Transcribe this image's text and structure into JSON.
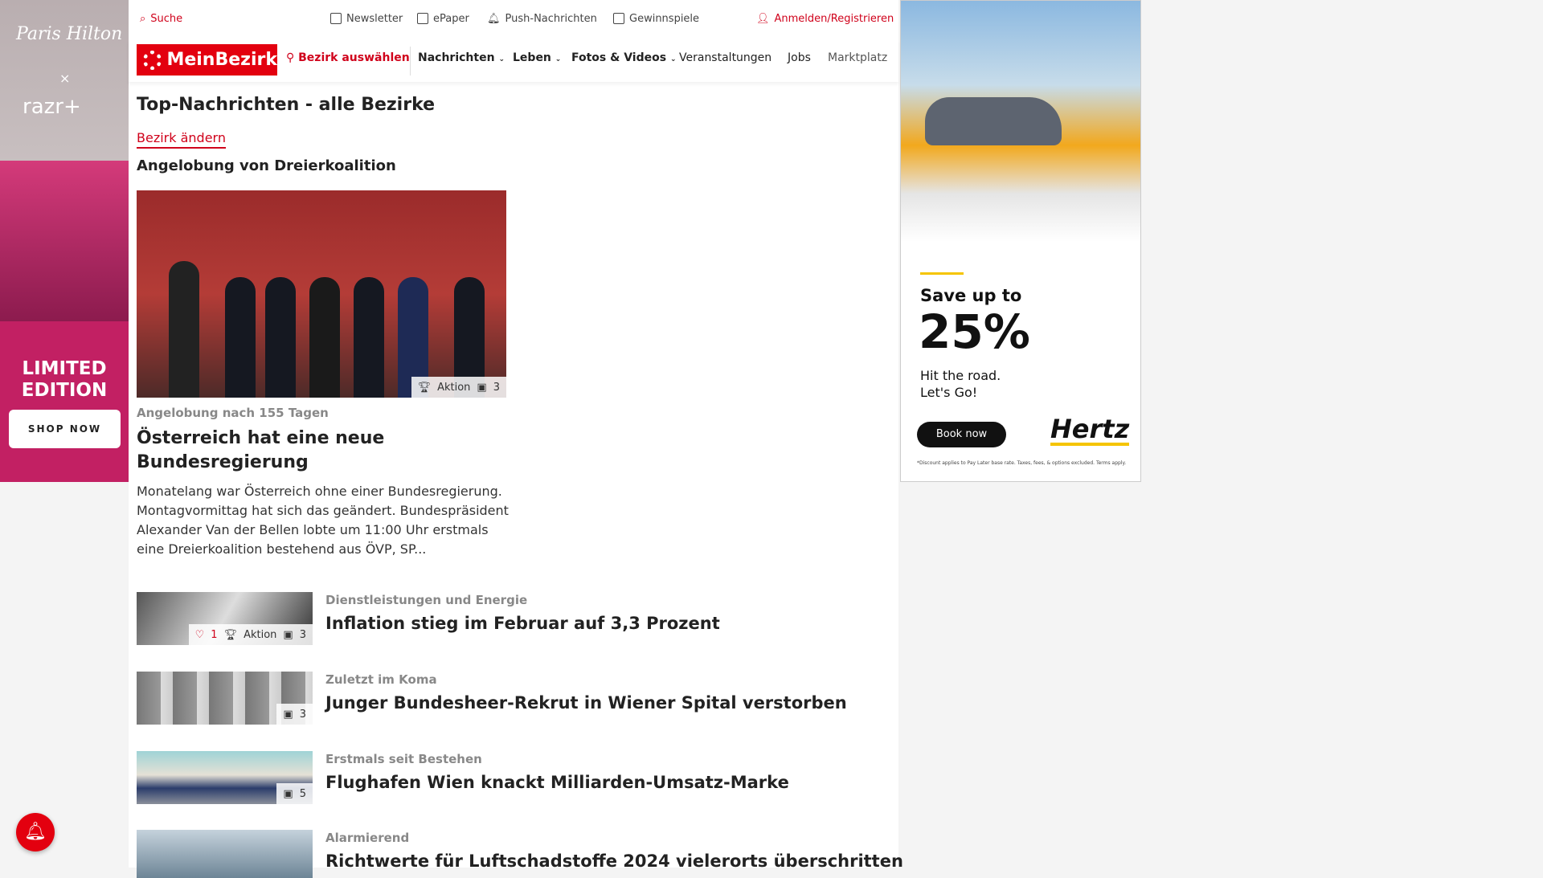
{
  "topbar": {
    "search": "Suche",
    "newsletter": "Newsletter",
    "epaper": "ePaper",
    "push": "Push-Nachrichten",
    "gewinnspiele": "Gewinnspiele",
    "login": "Anmelden/Registrieren"
  },
  "nav": {
    "logo": "MeinBezirk",
    "bezirk": "Bezirk auswählen",
    "items": [
      "Nachrichten",
      "Leben",
      "Fotos & Videos",
      "Veranstaltungen",
      "Jobs",
      "Marktplatz"
    ]
  },
  "page": {
    "title": "Top-Nachrichten - alle Bezirke",
    "change": "Bezirk ändern",
    "section": "Angelobung von Dreierkoalition"
  },
  "hero": {
    "badge_action": "Aktion",
    "badge_images": "3",
    "kicker": "Angelobung nach 155 Tagen",
    "headline": "Österreich hat eine neue Bundesregierung",
    "teaser": "Monatelang war Österreich ohne einer Bundesregierung. Montagvormittag hat sich das geändert. Bundespräsident Alexander Van der Bellen lobte um 11:00 Uhr erstmals eine Dreierkoalition bestehend aus ÖVP, SP..."
  },
  "articles": [
    {
      "kicker": "Dienstleistungen und Energie",
      "headline": "Inflation stieg im Februar auf 3,3 Prozent",
      "likes": "1",
      "action": "Aktion",
      "images": "3"
    },
    {
      "kicker": "Zuletzt im Koma",
      "headline": "Junger Bundesheer-Rekrut in Wiener Spital verstorben",
      "images": "3"
    },
    {
      "kicker": "Erstmals seit Bestehen",
      "headline": "Flughafen Wien knackt Milliarden-Umsatz-Marke",
      "images": "5"
    },
    {
      "kicker": "Alarmierend",
      "headline": "Richtwerte für Luftschadstoffe 2024 vielerorts überschritten"
    }
  ],
  "leftad": {
    "brand1": "Paris Hilton",
    "x": "×",
    "brand2": "razr+",
    "edition": "LIMITED EDITION",
    "cta": "SHOP NOW"
  },
  "rightad": {
    "save": "Save up to",
    "pct": "25%",
    "tag1": "Hit the road.",
    "tag2": "Let's Go!",
    "cta": "Book now",
    "brand": "Hertz",
    "fine": "*Discount applies to Pay Later base rate. Taxes, fees, & options excluded. Terms apply."
  },
  "colors": {
    "brand": "#e3000f",
    "accent": "#d0021b"
  }
}
